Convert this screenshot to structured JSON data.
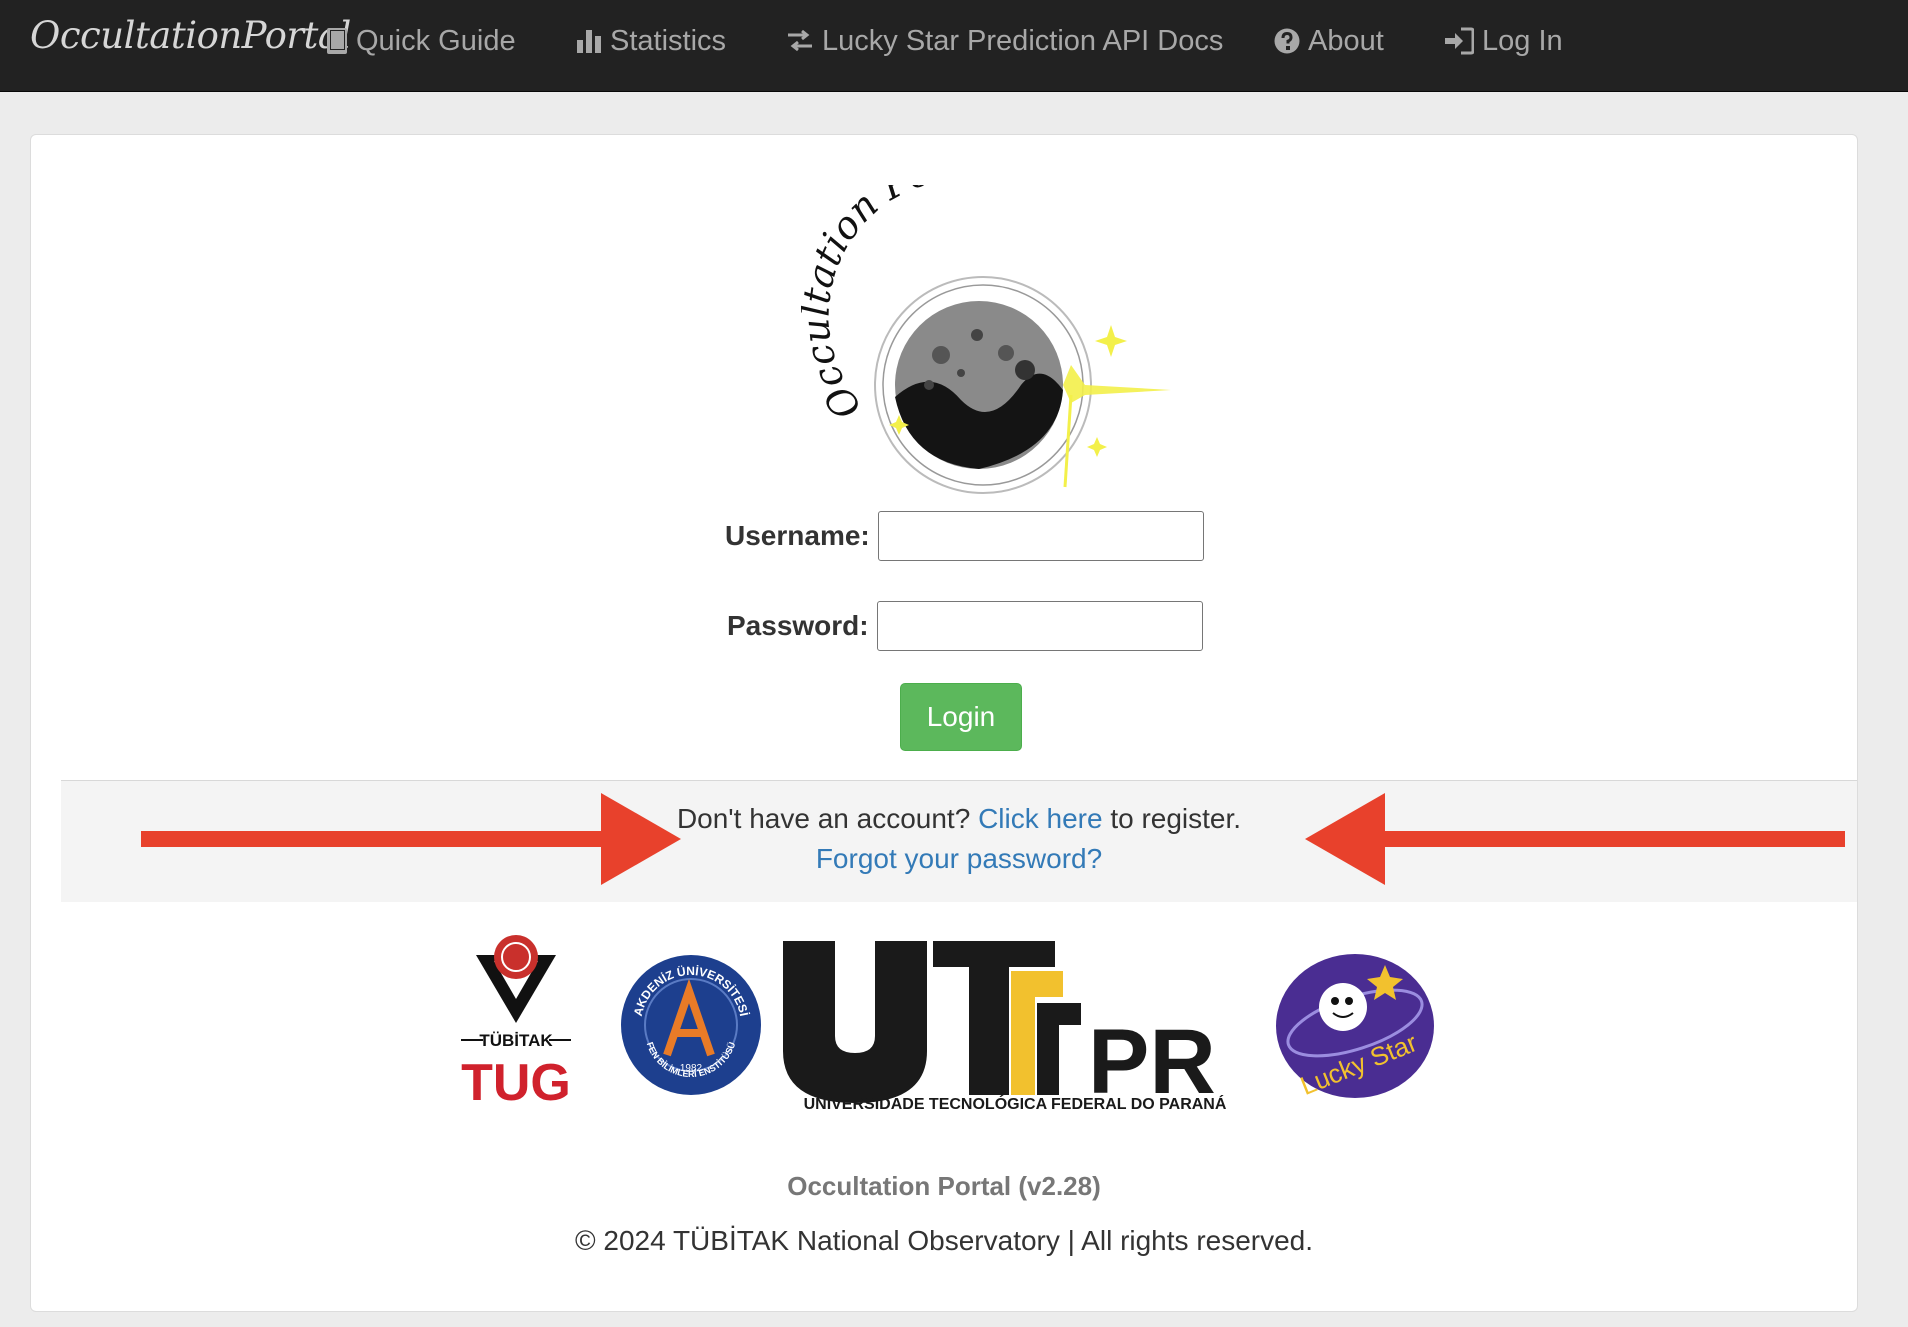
{
  "navbar": {
    "brand": "OccultationPortal",
    "items": [
      {
        "label": "Quick Guide",
        "icon": "book-icon"
      },
      {
        "label": "Statistics",
        "icon": "bar-chart-icon"
      },
      {
        "label": "Lucky Star Prediction API Docs",
        "icon": "transfer-icon"
      },
      {
        "label": "About",
        "icon": "question-circle-icon"
      },
      {
        "label": "Log In",
        "icon": "log-in-icon"
      }
    ]
  },
  "logo": {
    "text": "Occultation Portal"
  },
  "login_form": {
    "username_label": "Username:",
    "username_value": "",
    "password_label": "Password:",
    "password_value": "",
    "submit_label": "Login"
  },
  "register": {
    "prefix": "Don't have an account?",
    "link": "Click here",
    "suffix": "to register.",
    "forgot": "Forgot your password?"
  },
  "partner_logos": {
    "tubitak_label": "TÜBİTAK",
    "tug_label": "TUG",
    "akdeniz_top": "AKDENİZ ÜNİVERSİTESİ",
    "akdeniz_bottom": "FEN BİLİMLERİ ENSTİTÜSÜ",
    "akdeniz_year": "1982",
    "utfpr_label": "UTFPR",
    "utfpr_subtitle": "UNIVERSIDADE TECNOLÓGICA FEDERAL DO PARANÁ",
    "lucky_star_label": "Lucky Star"
  },
  "footer": {
    "version": "Occultation Portal (v2.28)",
    "copyright": "© 2024 TÜBİTAK National Observatory | All rights reserved."
  },
  "colors": {
    "navbar_bg": "#222222",
    "nav_text": "#a8a8a8",
    "login_green": "#5cb85c",
    "link_blue": "#337ab7",
    "arrow_red": "#e8412c"
  }
}
